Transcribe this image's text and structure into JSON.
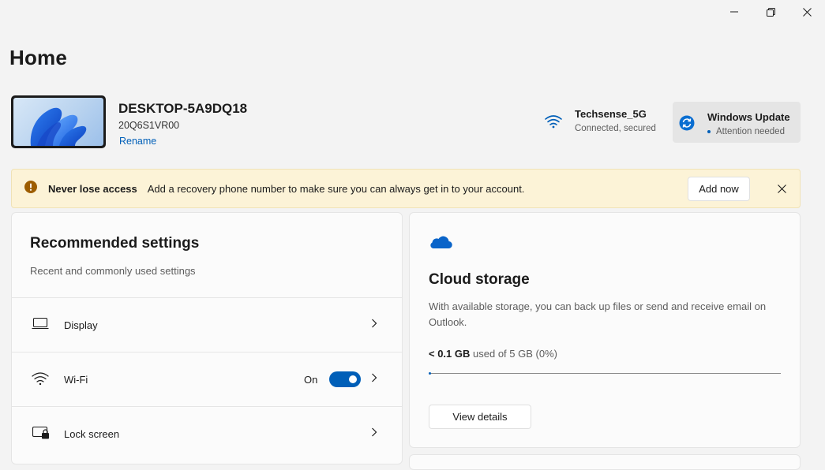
{
  "window": {
    "controls": [
      "minimize",
      "maximize",
      "close"
    ]
  },
  "page": {
    "title": "Home"
  },
  "device": {
    "name": "DESKTOP-5A9DQ18",
    "model": "20Q6S1VR00",
    "rename_label": "Rename"
  },
  "network": {
    "name": "Techsense_5G",
    "status": "Connected, secured",
    "icon": "wifi-icon"
  },
  "windows_update": {
    "title": "Windows Update",
    "status": "Attention needed",
    "icon": "sync-icon",
    "accent": "#005fb8"
  },
  "banner": {
    "title": "Never lose access",
    "message": "Add a recovery phone number to make sure you can always get in to your account.",
    "action_label": "Add now",
    "icon": "warning-icon",
    "warning_color": "#9d5d00"
  },
  "recommended": {
    "title": "Recommended settings",
    "subtitle": "Recent and commonly used settings",
    "items": [
      {
        "label": "Display",
        "icon": "display-icon"
      },
      {
        "label": "Wi-Fi",
        "icon": "wifi-icon",
        "toggle_label": "On",
        "toggle_on": true
      },
      {
        "label": "Lock screen",
        "icon": "lock-screen-icon"
      }
    ]
  },
  "cloud": {
    "icon": "cloud-icon",
    "title": "Cloud storage",
    "description": "With available storage, you can back up files or send and receive email on Outlook.",
    "used": "< 0.1 GB",
    "used_suffix": "used of 5 GB (0%)",
    "used_fraction": 0.005,
    "button_label": "View details"
  },
  "colors": {
    "accent": "#005fb8",
    "background": "#f3f3f3",
    "banner_bg": "#fcf3d7"
  }
}
